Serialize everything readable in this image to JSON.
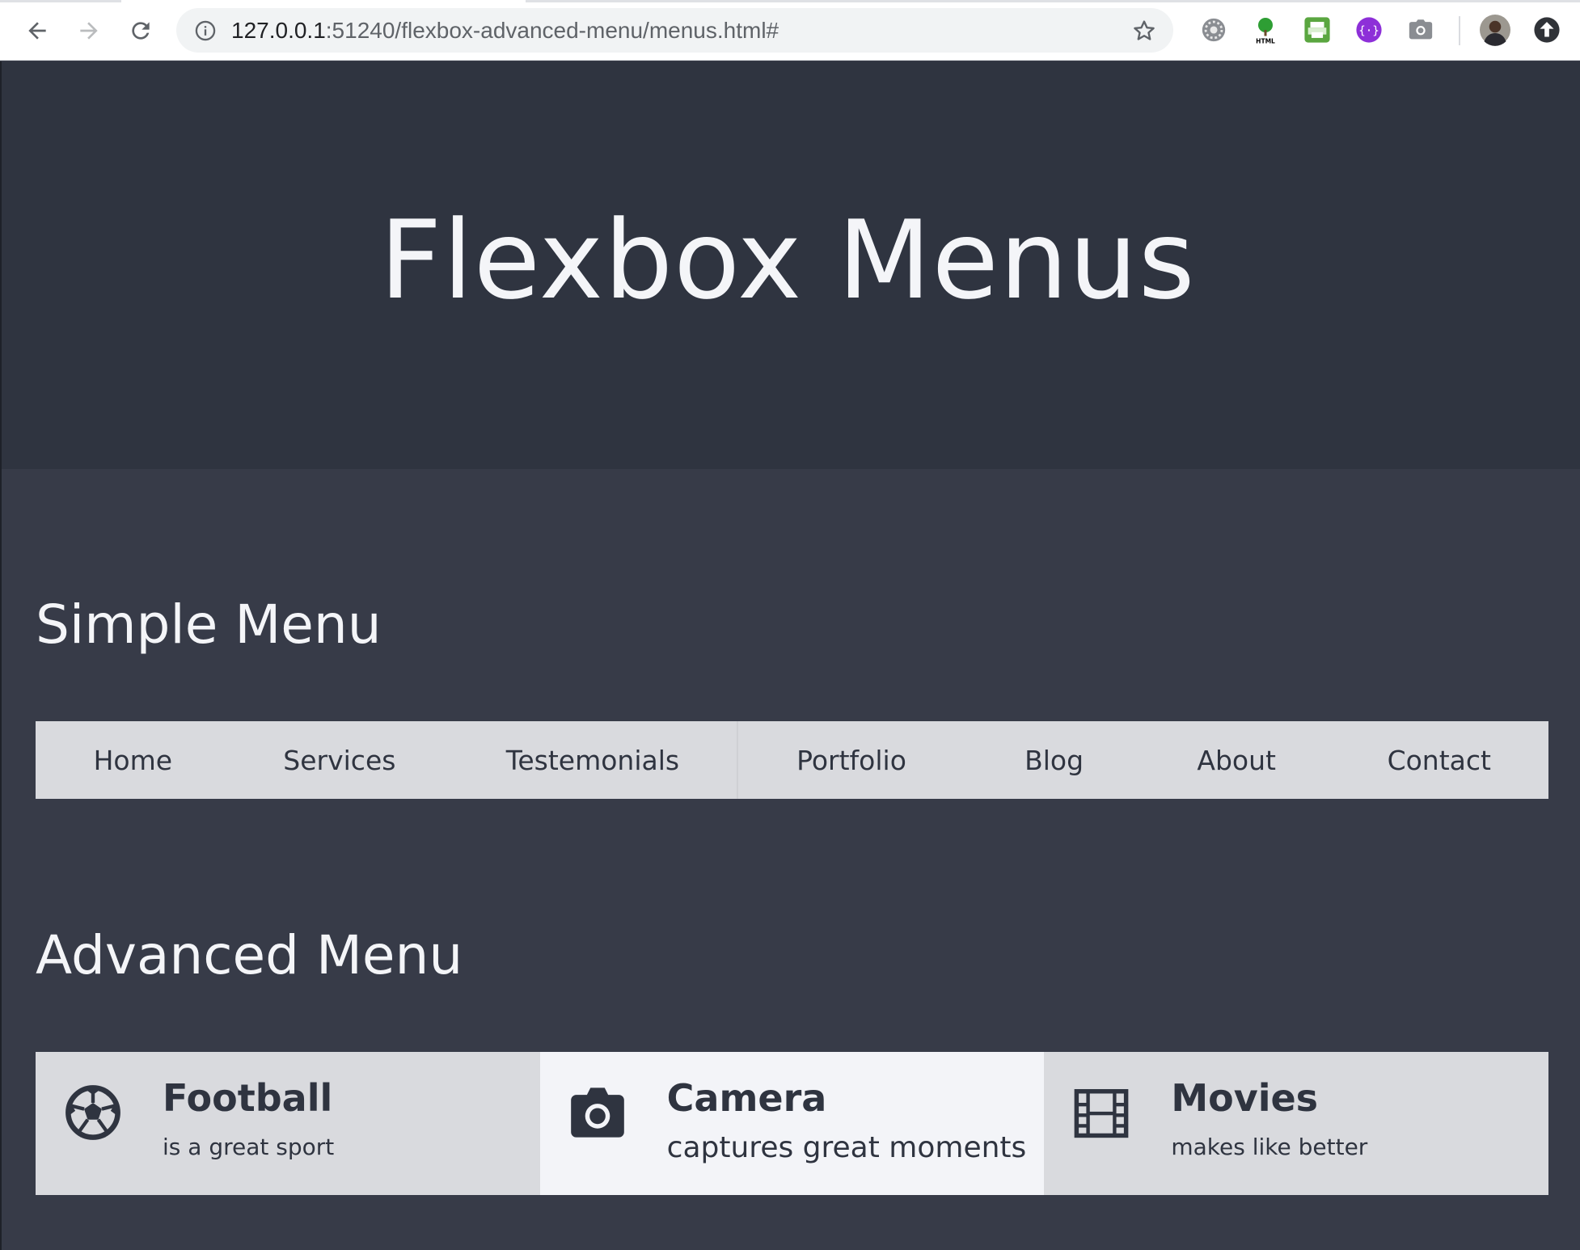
{
  "browser": {
    "url_host": "127.0.0.1",
    "url_rest": ":51240/flexbox-advanced-menu/menus.html#",
    "extensions": [
      "settings-gear-icon",
      "html-tree-icon",
      "print-icon",
      "code-icon",
      "camera-icon"
    ]
  },
  "hero": {
    "title": "Flexbox Menus"
  },
  "simple": {
    "title": "Simple Menu",
    "items": [
      "Home",
      "Services",
      "Testemonials",
      "Portfolio",
      "Blog",
      "About",
      "Contact"
    ]
  },
  "advanced": {
    "title": "Advanced Menu",
    "items": [
      {
        "title": "Football",
        "subtitle": "is a great sport",
        "icon": "soccer-ball-icon"
      },
      {
        "title": "Camera",
        "subtitle": "captures great moments",
        "icon": "camera-icon",
        "active": true
      },
      {
        "title": "Movies",
        "subtitle": "makes like better",
        "icon": "film-icon"
      }
    ]
  },
  "colors": {
    "hero_bg": "#2f3440",
    "page_bg": "#373b48",
    "menu_bg": "#d9dade",
    "menu_active_bg": "#f3f4f8",
    "text_dark": "#2f3440",
    "text_light": "#f4f5f8"
  }
}
